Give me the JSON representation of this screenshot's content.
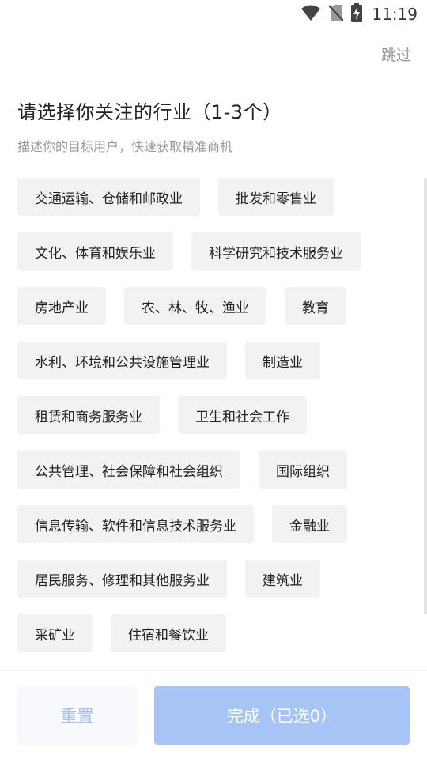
{
  "status_bar": {
    "time": "11:19",
    "icons": [
      "wifi-icon",
      "no-sim-icon",
      "battery-charging-icon"
    ]
  },
  "header": {
    "skip_label": "跳过",
    "title": "请选择你关注的行业（1-3个）",
    "subtitle": "描述你的目标用户，快速获取精准商机"
  },
  "industries": [
    "交通运输、仓储和邮政业",
    "批发和零售业",
    "文化、体育和娱乐业",
    "科学研究和技术服务业",
    "房地产业",
    "农、林、牧、渔业",
    "教育",
    "水利、环境和公共设施管理业",
    "制造业",
    "租赁和商务服务业",
    "卫生和社会工作",
    "公共管理、社会保障和社会组织",
    "国际组织",
    "信息传输、软件和信息技术服务业",
    "金融业",
    "居民服务、修理和其他服务业",
    "建筑业",
    "采矿业",
    "住宿和餐饮业"
  ],
  "footer": {
    "reset_label": "重置",
    "done_label": "完成（已选0）"
  },
  "colors": {
    "chip_bg": "#f2f2f2",
    "primary_disabled": "#a6c4f6",
    "reset_text": "#a8c0ec"
  }
}
